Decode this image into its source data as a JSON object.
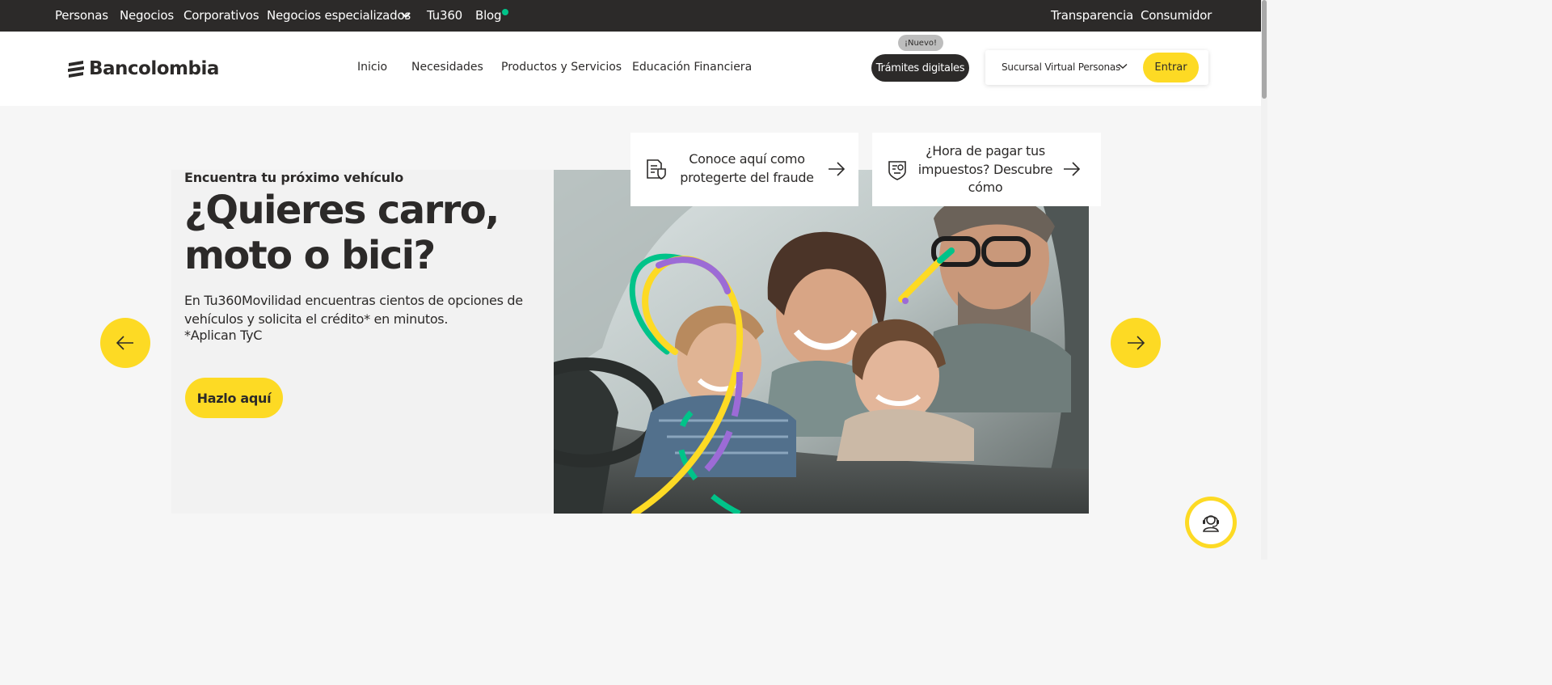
{
  "topbar": {
    "personas": "Personas",
    "negocios": "Negocios",
    "corporativos": "Corporativos",
    "negocios_especializados": "Negocios especializados",
    "tu360": "Tu360",
    "blog": "Blog",
    "transparencia": "Transparencia",
    "consumidor": "Consumidor"
  },
  "navbar": {
    "logo": "Bancolombia",
    "links": [
      "Inicio",
      "Necesidades",
      "Productos y Servicios",
      "Educación Financiera"
    ],
    "nuevo_badge": "¡Nuevo!",
    "tramites": "Trámites digitales",
    "sucursal": "Sucursal Virtual Personas",
    "entrar": "Entrar"
  },
  "hero": {
    "subtitle": "Encuentra tu próximo vehículo",
    "title": "¿Quieres carro, moto o bici?",
    "description": "En Tu360Movilidad encuentras cientos de opciones de vehículos y solicita el crédito* en minutos.",
    "tyc": "*Aplican TyC",
    "cta": "Hazlo aquí"
  },
  "cards": [
    {
      "text": "Conoce aquí como protegerte del fraude",
      "icon": "document-shield-icon"
    },
    {
      "text": "¿Hora de pagar tus impuestos? Descubre cómo",
      "icon": "tax-document-icon"
    }
  ],
  "colors": {
    "brand_yellow": "#fdda24",
    "dark": "#2c2a29",
    "accent_green": "#00c389",
    "accent_purple": "#9c6bd6"
  }
}
